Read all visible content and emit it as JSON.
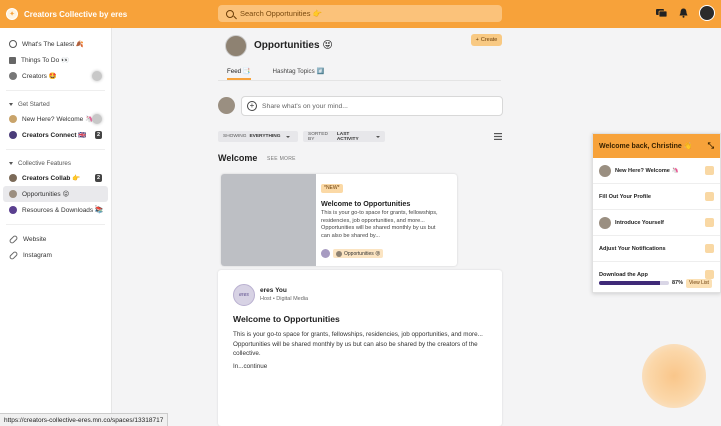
{
  "header": {
    "brand": "Creators Collective by eres",
    "search_placeholder": "Search Opportunities 👉"
  },
  "sidebar": {
    "top_items": [
      {
        "label": "What's The Latest 🍂"
      },
      {
        "label": "Things To Do 👀"
      },
      {
        "label": "Creators 🤩"
      }
    ],
    "section_get_started": "Get Started",
    "get_started_items": [
      {
        "label": "New Here? Welcome 🦄"
      },
      {
        "label": "Creators Connect 🇬🇧",
        "badge": "2"
      }
    ],
    "section_collective": "Collective Features",
    "collective_items": [
      {
        "label": "Creators Collab 👉",
        "badge": "2"
      },
      {
        "label": "Opportunities 😝"
      },
      {
        "label": "Resources & Downloads 📚"
      }
    ],
    "links": [
      {
        "label": "Website"
      },
      {
        "label": "Instagram"
      }
    ]
  },
  "space": {
    "title": "Opportunities 😝",
    "create_label": "Create",
    "tabs": [
      {
        "label": "Feed 📑"
      },
      {
        "label": "Hashtag Topics #️⃣"
      }
    ],
    "composer_placeholder": "Share what's on your mind...",
    "filters": {
      "showing_prefix": "SHOWING",
      "showing_value": "EVERYTHING",
      "sorted_prefix": "SORTED BY",
      "sorted_value": "LAST ACTIVITY"
    },
    "welcome_heading": "Welcome",
    "see_more": "SEE MORE"
  },
  "featured_card": {
    "tag": "*NEW*",
    "title": "Welcome to Opportunities",
    "text": "This is your go-to space for grants, fellowships, residencies, job opportunities, and more... Opportunities will be shared monthly by us but can also be shared by...",
    "space_pill": "Opportunities 😝"
  },
  "post": {
    "avatar_text": "eres",
    "author": "eres You",
    "role": "Host • Digital Media",
    "title": "Welcome to Opportunities",
    "body": "This is your go-to space for grants, fellowships, residencies, job opportunities, and more... Opportunities will be shared monthly by us but can also be shared by the creators of the collective.",
    "continue": "In...continue"
  },
  "onboarding": {
    "title": "Welcome back, Christine 👋",
    "steps": [
      {
        "label": "New Here? Welcome 🦄"
      },
      {
        "label": "Fill Out Your Profile"
      },
      {
        "label": "Introduce Yourself"
      },
      {
        "label": "Adjust Your Notifications"
      },
      {
        "label": "Download the App"
      }
    ],
    "progress_percent": 87,
    "progress_label": "87%",
    "view_list": "View List"
  },
  "watermark_text": "Creators Collective",
  "status_url": "https://creators-collective-eres.mn.co/spaces/13318717",
  "colors": {
    "brand_orange": "#f7a23a",
    "progress_purple": "#3f2a78"
  }
}
